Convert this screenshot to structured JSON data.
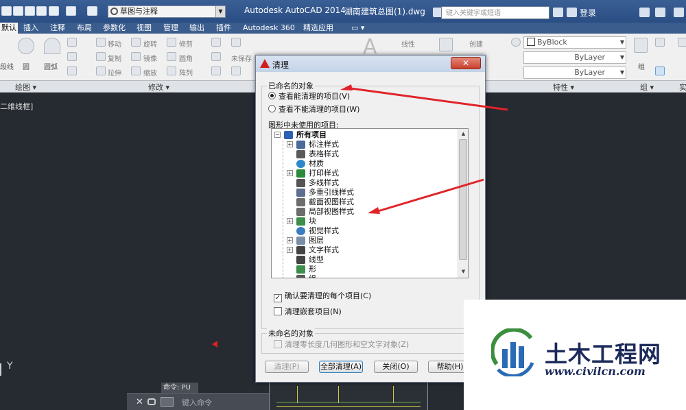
{
  "titlebar": {
    "workspace": "草图与注释",
    "app_title": "Autodesk AutoCAD 2014",
    "file_title": "湖南建筑总图(1).dwg",
    "search_placeholder": "键入关键字或短语",
    "login": "登录"
  },
  "ribbon_tabs": [
    {
      "label": "默认",
      "active": true
    },
    {
      "label": "插入"
    },
    {
      "label": "注释"
    },
    {
      "label": "布局"
    },
    {
      "label": "参数化"
    },
    {
      "label": "视图"
    },
    {
      "label": "管理"
    },
    {
      "label": "输出"
    },
    {
      "label": "插件"
    },
    {
      "label": "Autodesk 360"
    },
    {
      "label": "精选应用"
    }
  ],
  "ribbon": {
    "draw_left_label": "段线",
    "circle": "圆",
    "arc": "圆弧",
    "modify": {
      "move": "移动",
      "rotate": "旋转",
      "trim": "修剪",
      "copy": "复制",
      "mirror": "镜像",
      "fillet": "圆角",
      "stretch": "拉伸",
      "scale": "缩放",
      "array": "阵列"
    },
    "unsaved": "未保存",
    "linear": "线性",
    "create": "创建",
    "bylayer_color": "ByBlock",
    "linetype": "ByLayer",
    "lineweight": "ByLayer",
    "group": "组",
    "panels": {
      "draw": "绘图",
      "modify": "修改",
      "properties": "特性",
      "groups": "组",
      "util": "实"
    }
  },
  "canvas": {
    "view_label": "二维线框]",
    "axis_y": "Y",
    "command_history": "命令: PU",
    "command_placeholder": "键入命令"
  },
  "dialog": {
    "title": "清理",
    "close": "✕",
    "named_objects": "已命名的对象",
    "view_purgeable": "查看能清理的项目(V)",
    "view_nonpurgeable": "查看不能清理的项目(W)",
    "unused_items_label": "图形中未使用的项目:",
    "tree_root": "所有项目",
    "tree_items": [
      {
        "label": "标注样式",
        "expander": true,
        "icon": "dimstyle-icon",
        "color": "#4b6a9a"
      },
      {
        "label": "表格样式",
        "expander": false,
        "icon": "table-icon",
        "color": "#5a5a5a"
      },
      {
        "label": "材质",
        "expander": false,
        "icon": "material-sphere-icon",
        "color": "#2e88c9"
      },
      {
        "label": "打印样式",
        "expander": true,
        "icon": "plotstyle-icon",
        "color": "#2a8a3a"
      },
      {
        "label": "多线样式",
        "expander": false,
        "icon": "multiline-icon",
        "color": "#555555"
      },
      {
        "label": "多重引线样式",
        "expander": false,
        "icon": "mleader-icon",
        "color": "#5d6f8f"
      },
      {
        "label": "截面视图样式",
        "expander": false,
        "icon": "section-view-icon",
        "color": "#6c6c6c"
      },
      {
        "label": "局部视图样式",
        "expander": false,
        "icon": "detail-view-icon",
        "color": "#6c6c6c"
      },
      {
        "label": "块",
        "expander": true,
        "icon": "block-icon",
        "color": "#3d8e4a"
      },
      {
        "label": "视觉样式",
        "expander": false,
        "icon": "visualstyle-icon",
        "color": "#3a7cc0"
      },
      {
        "label": "图层",
        "expander": true,
        "icon": "layers-icon",
        "color": "#7a8ea8"
      },
      {
        "label": "文字样式",
        "expander": true,
        "icon": "textstyle-icon",
        "color": "#444444"
      },
      {
        "label": "线型",
        "expander": false,
        "icon": "linetype-icon",
        "color": "#444444"
      },
      {
        "label": "形",
        "expander": false,
        "icon": "shape-icon",
        "color": "#3d8e4a"
      },
      {
        "label": "组",
        "expander": false,
        "icon": "group-icon",
        "color": "#5a5a5a"
      }
    ],
    "confirm_each": "确认要清理的每个项目(C)",
    "purge_nested": "清理嵌套项目(N)",
    "unnamed_objects": "未命名的对象",
    "purge_zero_length": "清理零长度几何图形和空文字对象(Z)",
    "btn_purge": "清理(P)",
    "btn_purge_all": "全部清理(A)",
    "btn_close": "关闭(O)",
    "btn_help": "帮助(H)"
  },
  "watermark": {
    "brand_cn": "土木工程网",
    "url": "www.civilcn.com"
  },
  "colors": {
    "title_bar": "#2f5488",
    "canvas": "#262a31",
    "annotation_arrow": "#e0242a"
  }
}
